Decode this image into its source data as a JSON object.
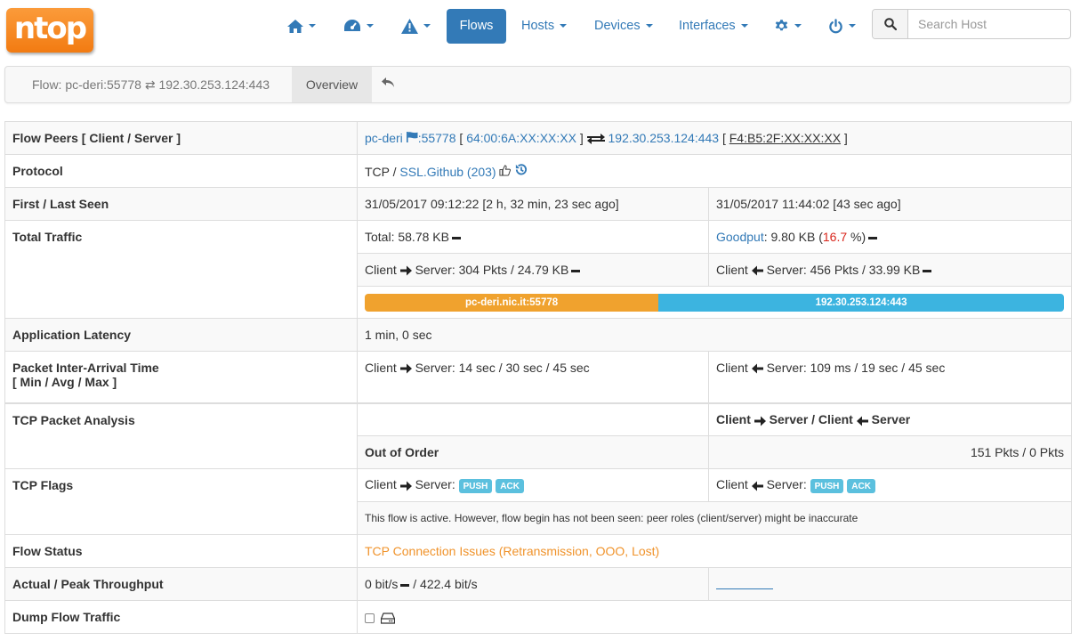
{
  "brand": {
    "logo_text": "ntop"
  },
  "nav": {
    "home_icon": "home-icon",
    "dashboard_icon": "dashboard-icon",
    "alerts_icon": "alert-icon",
    "flows": "Flows",
    "hosts": "Hosts",
    "devices": "Devices",
    "interfaces": "Interfaces",
    "settings_icon": "gear-icon",
    "power_icon": "power-icon",
    "search_placeholder": "Search Host"
  },
  "subnav": {
    "crumb": "Flow: pc-deri:55778 ⇄ 192.30.253.124:443",
    "overview_tab": "Overview"
  },
  "rows": {
    "peers": {
      "label": "Flow Peers [ Client / Server ]",
      "client_host": "pc-deri",
      "client_port": ":55778",
      "client_mac": "64:00:6A:XX:XX:XX",
      "server_host": "192.30.253.124",
      "server_port": ":443",
      "server_mac": "F4:B5:2F:XX:XX:XX"
    },
    "protocol": {
      "label": "Protocol",
      "l4": "TCP / ",
      "app": "SSL.Github (203)"
    },
    "seen": {
      "label": "First / Last Seen",
      "first": "31/05/2017 09:12:22 [2 h, 32 min, 23 sec ago]",
      "last": "31/05/2017 11:44:02 [43 sec ago]"
    },
    "traffic": {
      "label": "Total Traffic",
      "total": "Total: 58.78 KB",
      "goodput_label": "Goodput",
      "goodput_value": ": 9.80 KB (",
      "goodput_pct": "16.7",
      "goodput_end": " %)",
      "c2s": "Server: 304 Pkts / 24.79 KB",
      "s2c": "Server: 456 Pkts / 33.99 KB",
      "bar_client_label": "pc-deri.nic.it:55778",
      "bar_server_label": "192.30.253.124:443",
      "bar_client_fraction": 0.42,
      "client_word": "Client"
    },
    "latency": {
      "label": "Application Latency",
      "value": "1 min, 0 sec"
    },
    "iat": {
      "label_line1": "Packet Inter-Arrival Time",
      "label_line2": "[ Min / Avg / Max ]",
      "c2s": "Server: 14 sec / 30 sec / 45 sec",
      "s2c": "Server: 109 ms / 19 sec / 45 sec"
    },
    "tcp_analysis": {
      "label": "TCP Packet Analysis",
      "header_a": "Client",
      "header_b": "Server / Client",
      "header_c": "Server",
      "ooo_label": "Out of Order",
      "ooo_value": "151 Pkts / 0 Pkts"
    },
    "tcp_flags": {
      "label": "TCP Flags",
      "c2s_prefix": "Server:",
      "s2c_prefix": "Server:",
      "flag_push": "PUSH",
      "flag_ack": "ACK",
      "note": "This flow is active. However, flow begin has not been seen: peer roles (client/server) might be inaccurate"
    },
    "status": {
      "label": "Flow Status",
      "value": "TCP Connection Issues (Retransmission, OOO, Lost)"
    },
    "throughput": {
      "label": "Actual / Peak Throughput",
      "actual": "0 bit/s",
      "peak": " / 422.4 bit/s"
    },
    "dump": {
      "label": "Dump Flow Traffic"
    }
  },
  "colors": {
    "brand_orange": "#f27b12",
    "link_blue": "#337ab7",
    "client_bar": "#f0a22e",
    "server_bar": "#3cb4e0",
    "status_orange": "#f0932b"
  }
}
